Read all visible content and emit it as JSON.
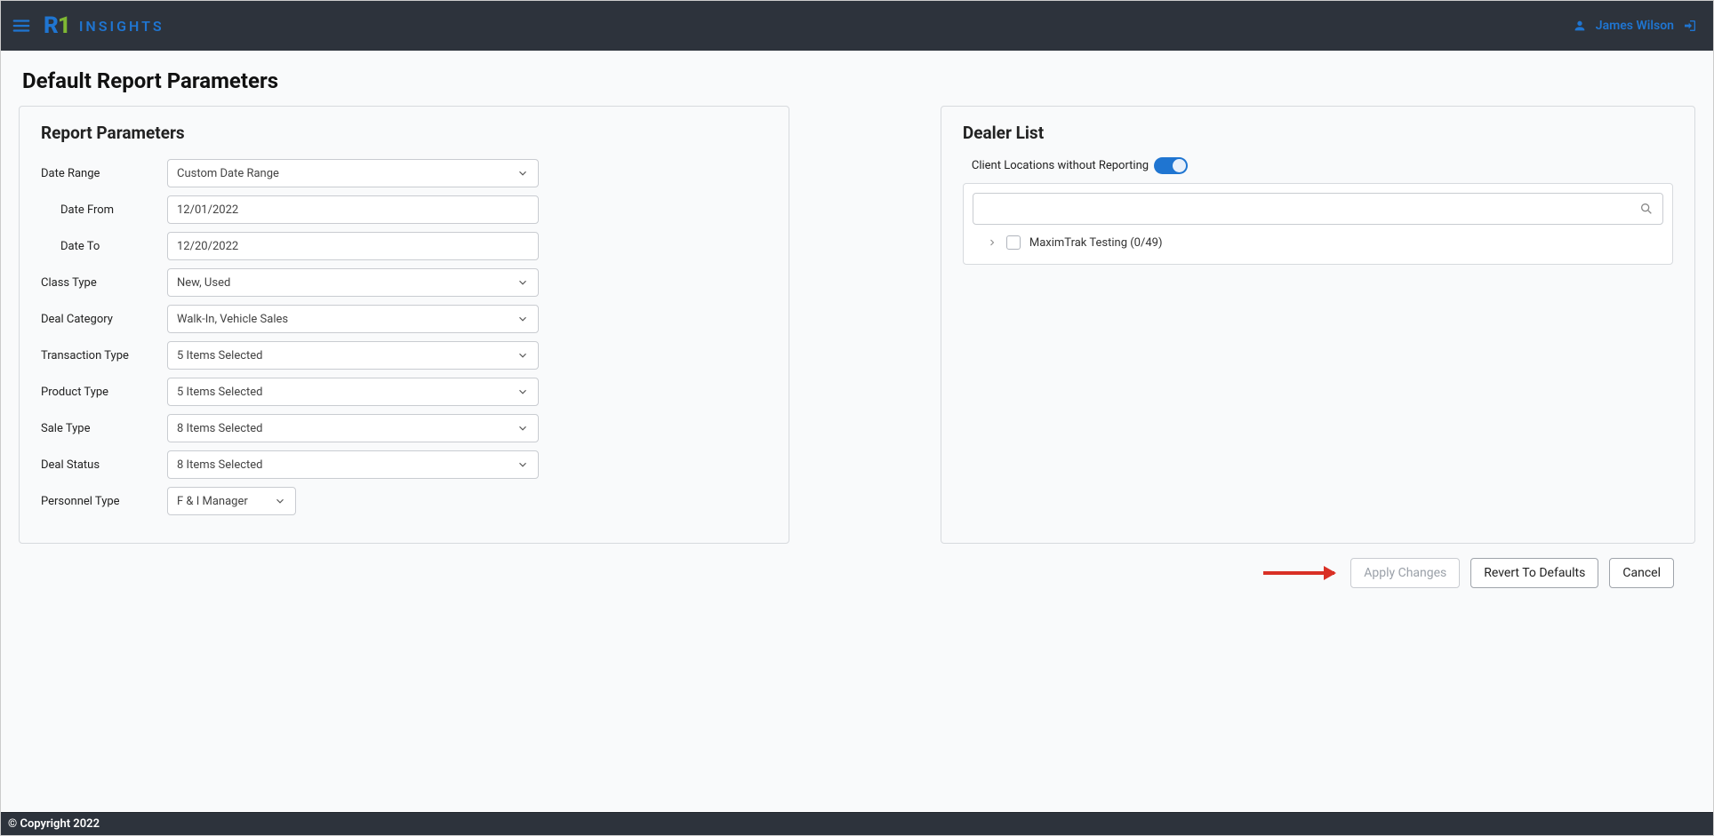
{
  "header": {
    "brand_text": "INSIGHTS",
    "user_name": "James Wilson"
  },
  "page": {
    "title": "Default Report Parameters"
  },
  "report_parameters": {
    "panel_title": "Report Parameters",
    "labels": {
      "date_range": "Date Range",
      "date_from": "Date From",
      "date_to": "Date To",
      "class_type": "Class Type",
      "deal_category": "Deal Category",
      "transaction_type": "Transaction Type",
      "product_type": "Product Type",
      "sale_type": "Sale Type",
      "deal_status": "Deal Status",
      "personnel_type": "Personnel Type"
    },
    "values": {
      "date_range": "Custom Date Range",
      "date_from": "12/01/2022",
      "date_to": "12/20/2022",
      "class_type": "New, Used",
      "deal_category": "Walk-In, Vehicle Sales",
      "transaction_type": "5 Items Selected",
      "product_type": "5 Items Selected",
      "sale_type": "8 Items Selected",
      "deal_status": "8 Items Selected",
      "personnel_type": "F & I Manager"
    }
  },
  "dealer_list": {
    "panel_title": "Dealer List",
    "toggle_label": "Client Locations without Reporting",
    "tree_item": "MaximTrak Testing (0/49)"
  },
  "actions": {
    "apply": "Apply Changes",
    "revert": "Revert To Defaults",
    "cancel": "Cancel"
  },
  "footer": {
    "copyright": "© Copyright 2022"
  }
}
